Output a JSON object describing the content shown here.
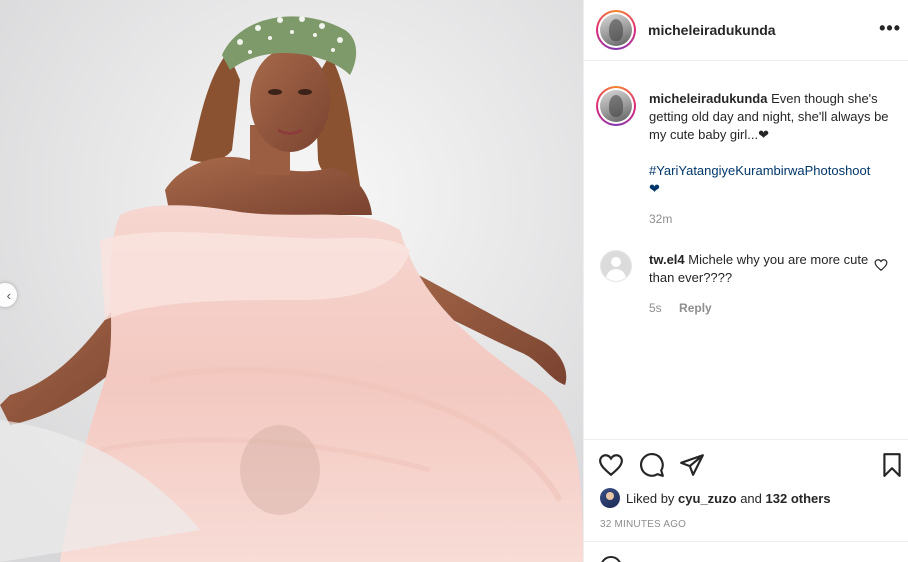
{
  "post": {
    "username": "micheleiradukunda",
    "more_icon": "more-horizontal-icon",
    "caption_username": "micheleiradukunda",
    "caption_text": "Even though she's getting old day and night, she'll always be my cute baby girl...❤",
    "hashtag": "#YariYatangiyeKurambirwaPhotoshoot",
    "hashtag_suffix": "❤",
    "caption_time": "32m"
  },
  "comment": {
    "username": "tw.el4",
    "text": "Michele why you are more cute than ever????",
    "time": "5s",
    "reply_label": "Reply"
  },
  "actions": {
    "liked_by_prefix": "Liked by",
    "liked_by_user": "cyu_zuzo",
    "and_text": "and",
    "others": "132 others",
    "timestamp": "32 MINUTES AGO"
  },
  "icons": [
    "heart-icon",
    "comment-icon",
    "share-icon",
    "bookmark-icon",
    "chevron-left-icon",
    "emoji-icon"
  ],
  "colors": {
    "hashtag": "#00376b",
    "muted": "#8e8e8e",
    "text": "#262626",
    "border": "#efefef"
  }
}
